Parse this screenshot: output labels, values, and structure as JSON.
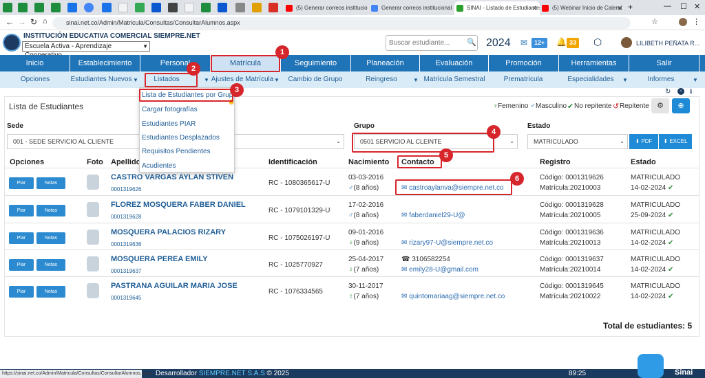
{
  "browser": {
    "tabs": [
      {
        "label": "(5) Generar correos institucio"
      },
      {
        "label": "Generar correos institucional"
      },
      {
        "label": "SINAI - Listado de Estudiantes"
      },
      {
        "label": "(5) Webinar Inicio de Calend"
      }
    ],
    "url": "sinai.net.co/Admin/Matricula/Consultas/ConsultarAlumnos.aspx",
    "status_url": "https://sinai.net.co/Admin/Matricula/Consultas/ConsultarAlumnos.aspx",
    "time": "89:25"
  },
  "header": {
    "institution": "INSTITUCIÓN EDUCATIVA COMERCIAL SIEMPRE.NET",
    "model_selected": "Escuela Activa - Aprendizaje Cooperativo",
    "search_placeholder": "Buscar estudiante...",
    "year": "2024",
    "mail_count": "12+",
    "bell_count": "33",
    "user_name": "LILIBETH PEÑATA R..."
  },
  "main_menu": [
    "Inicio",
    "Establecimiento",
    "Personal",
    "Matrícula",
    "Seguimiento",
    "Planeación",
    "Evaluación",
    "Promoción",
    "Herramientas",
    "Salir"
  ],
  "sub_menu": [
    "Opciones",
    "Estudiantes Nuevos",
    "Listados",
    "Ajustes de Matrícula",
    "Cambio de Grupo",
    "Reingreso",
    "Matrícula Semestral",
    "Prematrícula",
    "Especialidades",
    "Informes"
  ],
  "dropdown": [
    "Lista de Estudiantes por Grupo",
    "Cargar fotografías",
    "Estudiantes PIAR",
    "Estudiantes Desplazados",
    "Requisitos Pendientes",
    "Acudientes"
  ],
  "callouts": [
    "1",
    "2",
    "3",
    "4",
    "5",
    "6"
  ],
  "page": {
    "title": "Lista de Estudiantes",
    "legend": {
      "female": "Femenino",
      "male": "Masculino",
      "not_repeat": "No repitente",
      "repeat": "Repitente"
    },
    "filters": {
      "sede_label": "Sede",
      "sede_value": "001 - SEDE SERVICIO AL CLIENTE",
      "grupo_label": "Grupo",
      "grupo_value": "0501 SERVICIO AL CLEINTE",
      "estado_label": "Estado",
      "estado_value": "MATRICULADO",
      "pdf_label": "PDF",
      "excel_label": "EXCEL"
    },
    "columns": [
      "Opciones",
      "Foto",
      "Apellidos",
      "Identificación",
      "Nacimiento",
      "Contacto",
      "Registro",
      "Estado"
    ],
    "btn_piar": "Piar",
    "btn_notas": "Notas",
    "rows": [
      {
        "name": "CASTRO VARGAS AYLAN STIVEN",
        "code": "0001319626",
        "id": "RC - 1080365617-U",
        "birth": "03-03-2016",
        "age": "(8 años)",
        "phone": "",
        "email": "castroaylanva@siempre.net.co",
        "reg_code": "Código:   0001319626",
        "reg_mat": "Matrícula:20210003",
        "status": "MATRICULADO",
        "status_date": "14-02-2024",
        "gender": "male"
      },
      {
        "name": "FLOREZ MOSQUERA FABER DANIEL",
        "code": "0001319628",
        "id": "RC - 1079101329-U",
        "birth": "17-02-2016",
        "age": "(8 años)",
        "phone": "",
        "email": "faberdaniel29-U@",
        "reg_code": "Código:   0001319628",
        "reg_mat": "Matrícula:20210005",
        "status": "MATRICULADO",
        "status_date": "25-09-2024",
        "gender": "male"
      },
      {
        "name": "MOSQUERA PALACIOS RIZARY",
        "code": "0001319636",
        "id": "RC - 1075026197-U",
        "birth": "09-01-2016",
        "age": "(9 años)",
        "phone": "",
        "email": "rizary97-U@siempre.net.co",
        "reg_code": "Código:   0001319636",
        "reg_mat": "Matrícula:20210013",
        "status": "MATRICULADO",
        "status_date": "14-02-2024",
        "gender": "female"
      },
      {
        "name": "MOSQUERA PEREA EMILY",
        "code": "0001319637",
        "id": "RC - 1025770927",
        "birth": "25-04-2017",
        "age": "(7 años)",
        "phone": "3106582254",
        "email": "emily28-U@gmail.com",
        "reg_code": "Código:   0001319637",
        "reg_mat": "Matrícula:20210014",
        "status": "MATRICULADO",
        "status_date": "14-02-2024",
        "gender": "female"
      },
      {
        "name": "PASTRANA AGUILAR MARIA JOSE",
        "code": "0001319645",
        "id": "RC - 1076334565",
        "birth": "30-11-2017",
        "age": "(7 años)",
        "phone": "",
        "email": "quintomariaag@siempre.net.co",
        "reg_code": "Código:   0001319645",
        "reg_mat": "Matrícula:20210022",
        "status": "MATRICULADO",
        "status_date": "14-02-2024",
        "gender": "female"
      }
    ],
    "total": "Total de estudiantes: 5"
  },
  "footer": {
    "dev_label": "Desarrollador",
    "dev_name": "SIEMPRE.NET S.A.S",
    "year": "© 2025",
    "brand": "Sinai"
  },
  "colors": {
    "menu_blue": "#1f73b7",
    "submenu_bg": "#d8ebf7",
    "callout_red": "#d6262b",
    "link_blue": "#1f5d96",
    "check_green": "#2e8b3a"
  }
}
